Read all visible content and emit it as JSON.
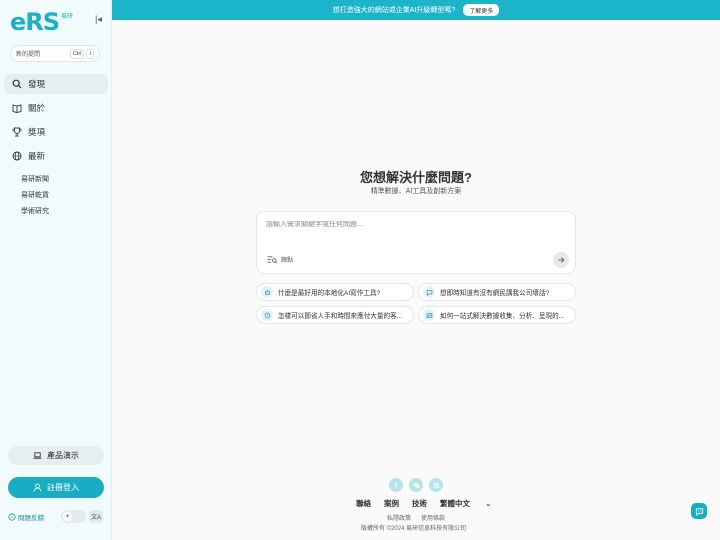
{
  "logo": {
    "text": "eRS",
    "sub": "易研"
  },
  "sidebar": {
    "new_question": "新的提問",
    "shortcut": [
      "Ctrl",
      "I"
    ],
    "nav": [
      {
        "label": "發現",
        "icon": "search-icon"
      },
      {
        "label": "關於",
        "icon": "book-icon"
      },
      {
        "label": "獎項",
        "icon": "trophy-icon"
      },
      {
        "label": "最新",
        "icon": "globe-icon"
      }
    ],
    "sub_items": [
      "易研新聞",
      "易研乾貨",
      "學術研究"
    ],
    "demo_label": "產品演示",
    "login_label": "註冊登入",
    "feedback_label": "問題反饋",
    "lang_toggle": "文A"
  },
  "banner": {
    "text": "想打造強大的網站或企業AI升級轉型嗎?",
    "button": "了解更多"
  },
  "hero": {
    "title": "您想解決什麼問題?",
    "subtitle": "精準數據、AI工具及創新方案"
  },
  "search": {
    "placeholder": "請輸入需求關鍵字或任何問題...",
    "filter_label": "篩點"
  },
  "suggestions": [
    "什麼是最好用的本地化AI寫作工具?",
    "想即時知道有沒有網民講我公司壞話?",
    "怎樣可以節省人手和時間來應付大量的客...",
    "如何一站式解決數據收集、分析、呈現的..."
  ],
  "footer": {
    "links": [
      "聯絡",
      "案例",
      "技術",
      "繁體中文"
    ],
    "legal": [
      "私隱政策",
      "使用條款"
    ],
    "copyright": "版權所有 ©2024 易研信息科技有限公司"
  },
  "colors": {
    "accent": "#19adc4",
    "banner": "#1cb4c8",
    "sidebar_bg": "#f1fbfc"
  }
}
